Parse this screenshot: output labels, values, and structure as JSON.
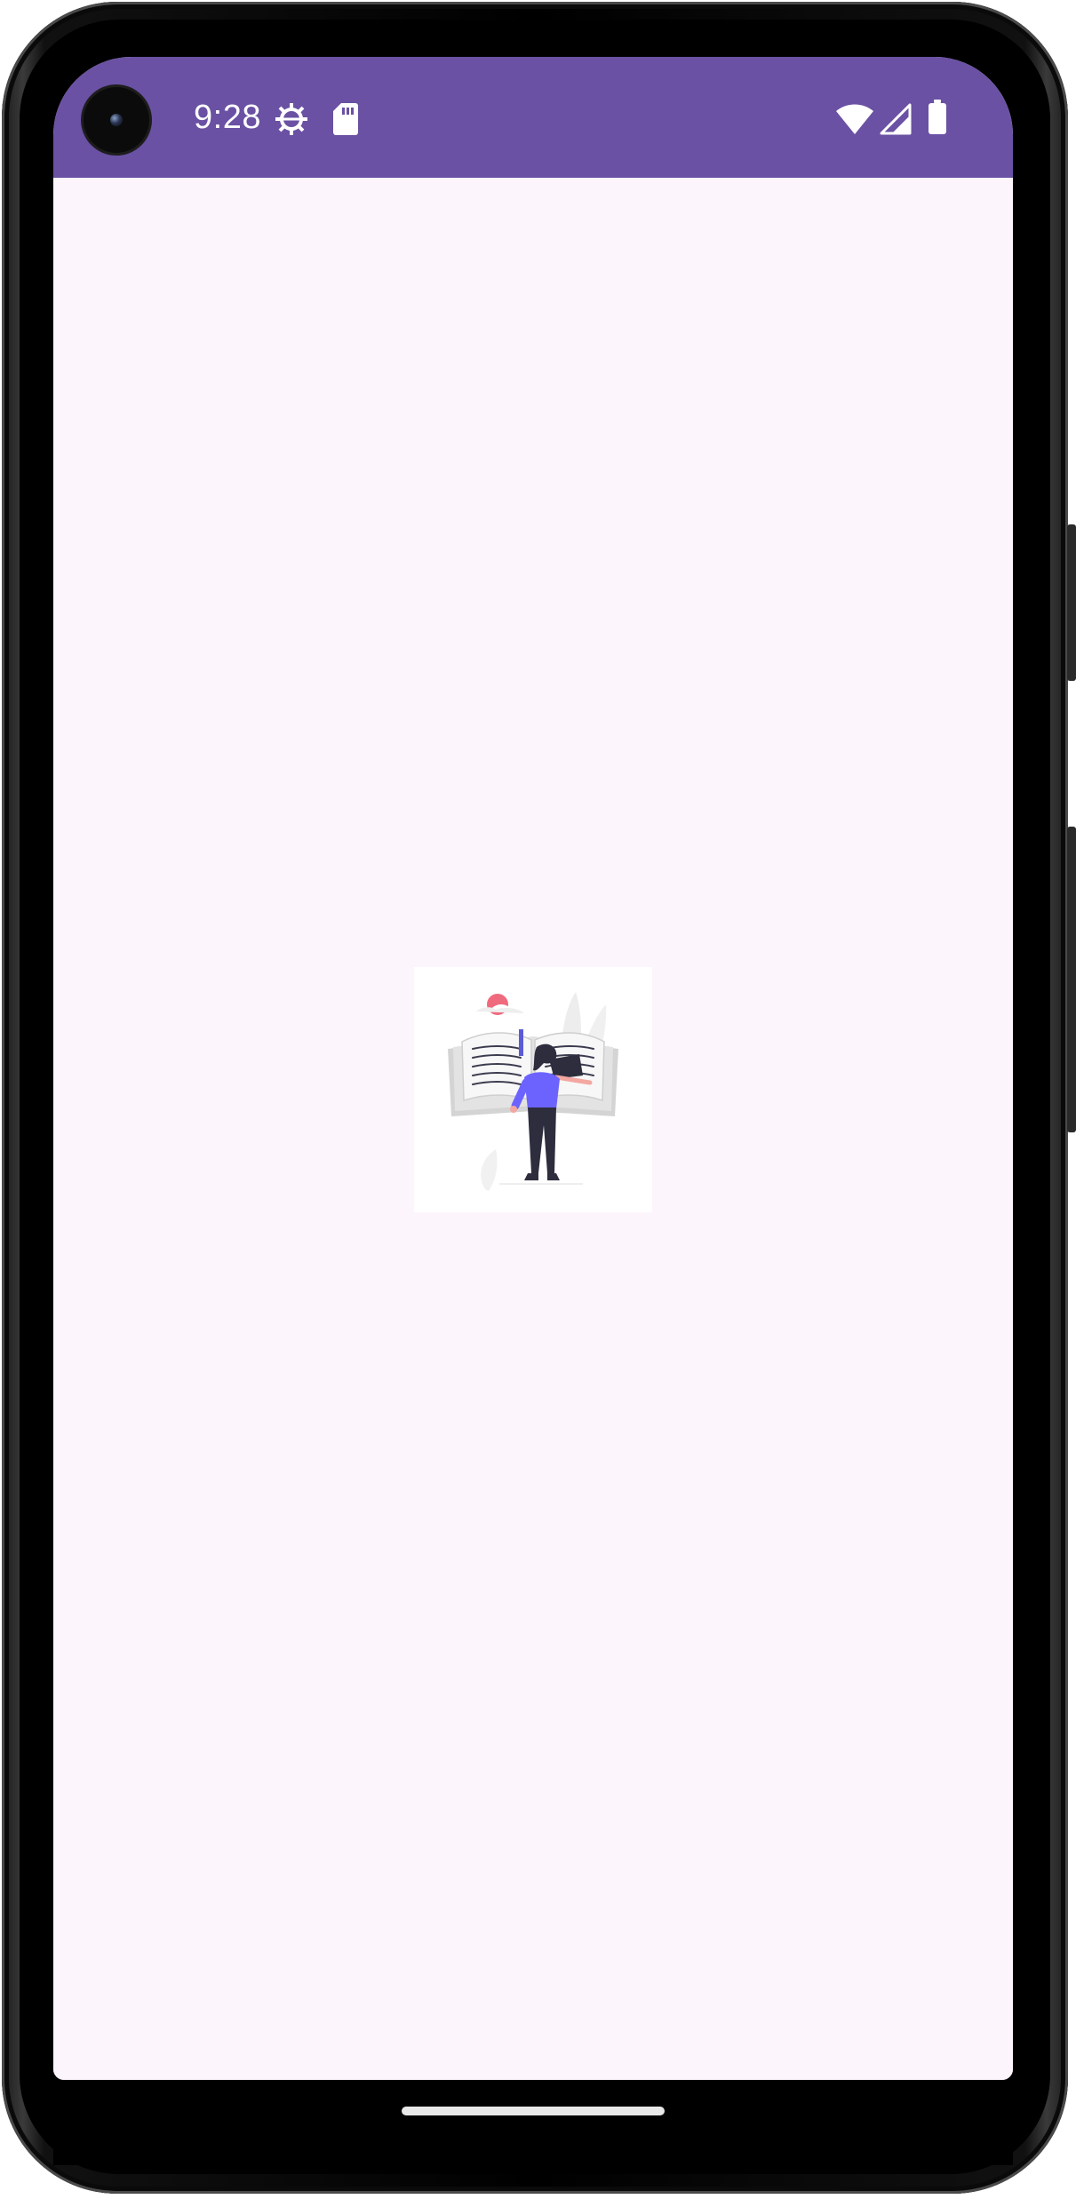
{
  "status_bar": {
    "time": "9:28",
    "left_icons": [
      "settings-gear-icon",
      "sd-card-icon"
    ],
    "right_icons": [
      "wifi-icon",
      "cellular-signal-icon",
      "battery-icon"
    ],
    "background_color": "#6a51a3"
  },
  "app": {
    "background_color": "#fcf5fc",
    "center_image": "book-reading-woman-illustration"
  },
  "navigation": {
    "gesture_handle": "home-handle"
  }
}
